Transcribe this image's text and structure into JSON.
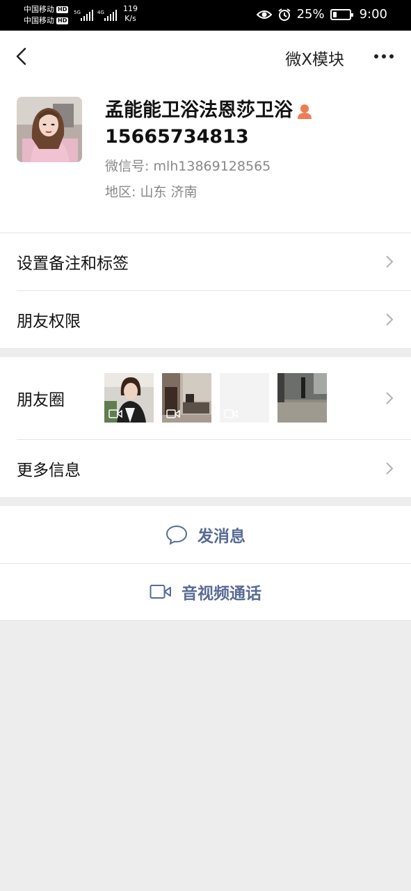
{
  "status_bar": {
    "carrier_1": "中国移动",
    "carrier_2": "中国移动",
    "hd_badge": "HD",
    "net_type_1": "5G",
    "net_type_2": "4G",
    "speed_value": "119",
    "speed_unit": "K/s",
    "battery": "25%",
    "battery_level": 0.25,
    "time": "9:00"
  },
  "nav": {
    "title": "微X模块"
  },
  "profile": {
    "name": "孟能能卫浴法恩莎卫浴",
    "phone": "15665734813",
    "wechat_id": "微信号: mlh13869128565",
    "region": "地区: 山东  济南",
    "name_icon": "person-icon",
    "name_icon_color": "#f07c54"
  },
  "settings": {
    "remark_label": "设置备注和标签",
    "permission_label": "朋友权限"
  },
  "info": {
    "moments_label": "朋友圈",
    "more_label": "更多信息"
  },
  "actions": {
    "message_label": "发消息",
    "call_label": "音视频通话"
  },
  "colors": {
    "link": "#576b95",
    "background": "#ededed"
  }
}
